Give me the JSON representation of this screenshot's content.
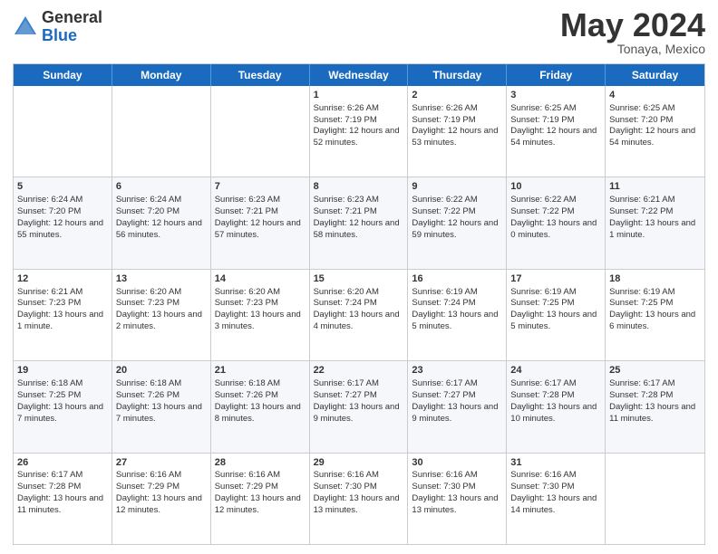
{
  "header": {
    "logo_general": "General",
    "logo_blue": "Blue",
    "month": "May 2024",
    "location": "Tonaya, Mexico"
  },
  "weekdays": [
    "Sunday",
    "Monday",
    "Tuesday",
    "Wednesday",
    "Thursday",
    "Friday",
    "Saturday"
  ],
  "rows": [
    [
      {
        "day": "",
        "sunrise": "",
        "sunset": "",
        "daylight": ""
      },
      {
        "day": "",
        "sunrise": "",
        "sunset": "",
        "daylight": ""
      },
      {
        "day": "",
        "sunrise": "",
        "sunset": "",
        "daylight": ""
      },
      {
        "day": "1",
        "sunrise": "Sunrise: 6:26 AM",
        "sunset": "Sunset: 7:19 PM",
        "daylight": "Daylight: 12 hours and 52 minutes."
      },
      {
        "day": "2",
        "sunrise": "Sunrise: 6:26 AM",
        "sunset": "Sunset: 7:19 PM",
        "daylight": "Daylight: 12 hours and 53 minutes."
      },
      {
        "day": "3",
        "sunrise": "Sunrise: 6:25 AM",
        "sunset": "Sunset: 7:19 PM",
        "daylight": "Daylight: 12 hours and 54 minutes."
      },
      {
        "day": "4",
        "sunrise": "Sunrise: 6:25 AM",
        "sunset": "Sunset: 7:20 PM",
        "daylight": "Daylight: 12 hours and 54 minutes."
      }
    ],
    [
      {
        "day": "5",
        "sunrise": "Sunrise: 6:24 AM",
        "sunset": "Sunset: 7:20 PM",
        "daylight": "Daylight: 12 hours and 55 minutes."
      },
      {
        "day": "6",
        "sunrise": "Sunrise: 6:24 AM",
        "sunset": "Sunset: 7:20 PM",
        "daylight": "Daylight: 12 hours and 56 minutes."
      },
      {
        "day": "7",
        "sunrise": "Sunrise: 6:23 AM",
        "sunset": "Sunset: 7:21 PM",
        "daylight": "Daylight: 12 hours and 57 minutes."
      },
      {
        "day": "8",
        "sunrise": "Sunrise: 6:23 AM",
        "sunset": "Sunset: 7:21 PM",
        "daylight": "Daylight: 12 hours and 58 minutes."
      },
      {
        "day": "9",
        "sunrise": "Sunrise: 6:22 AM",
        "sunset": "Sunset: 7:22 PM",
        "daylight": "Daylight: 12 hours and 59 minutes."
      },
      {
        "day": "10",
        "sunrise": "Sunrise: 6:22 AM",
        "sunset": "Sunset: 7:22 PM",
        "daylight": "Daylight: 13 hours and 0 minutes."
      },
      {
        "day": "11",
        "sunrise": "Sunrise: 6:21 AM",
        "sunset": "Sunset: 7:22 PM",
        "daylight": "Daylight: 13 hours and 1 minute."
      }
    ],
    [
      {
        "day": "12",
        "sunrise": "Sunrise: 6:21 AM",
        "sunset": "Sunset: 7:23 PM",
        "daylight": "Daylight: 13 hours and 1 minute."
      },
      {
        "day": "13",
        "sunrise": "Sunrise: 6:20 AM",
        "sunset": "Sunset: 7:23 PM",
        "daylight": "Daylight: 13 hours and 2 minutes."
      },
      {
        "day": "14",
        "sunrise": "Sunrise: 6:20 AM",
        "sunset": "Sunset: 7:23 PM",
        "daylight": "Daylight: 13 hours and 3 minutes."
      },
      {
        "day": "15",
        "sunrise": "Sunrise: 6:20 AM",
        "sunset": "Sunset: 7:24 PM",
        "daylight": "Daylight: 13 hours and 4 minutes."
      },
      {
        "day": "16",
        "sunrise": "Sunrise: 6:19 AM",
        "sunset": "Sunset: 7:24 PM",
        "daylight": "Daylight: 13 hours and 5 minutes."
      },
      {
        "day": "17",
        "sunrise": "Sunrise: 6:19 AM",
        "sunset": "Sunset: 7:25 PM",
        "daylight": "Daylight: 13 hours and 5 minutes."
      },
      {
        "day": "18",
        "sunrise": "Sunrise: 6:19 AM",
        "sunset": "Sunset: 7:25 PM",
        "daylight": "Daylight: 13 hours and 6 minutes."
      }
    ],
    [
      {
        "day": "19",
        "sunrise": "Sunrise: 6:18 AM",
        "sunset": "Sunset: 7:25 PM",
        "daylight": "Daylight: 13 hours and 7 minutes."
      },
      {
        "day": "20",
        "sunrise": "Sunrise: 6:18 AM",
        "sunset": "Sunset: 7:26 PM",
        "daylight": "Daylight: 13 hours and 7 minutes."
      },
      {
        "day": "21",
        "sunrise": "Sunrise: 6:18 AM",
        "sunset": "Sunset: 7:26 PM",
        "daylight": "Daylight: 13 hours and 8 minutes."
      },
      {
        "day": "22",
        "sunrise": "Sunrise: 6:17 AM",
        "sunset": "Sunset: 7:27 PM",
        "daylight": "Daylight: 13 hours and 9 minutes."
      },
      {
        "day": "23",
        "sunrise": "Sunrise: 6:17 AM",
        "sunset": "Sunset: 7:27 PM",
        "daylight": "Daylight: 13 hours and 9 minutes."
      },
      {
        "day": "24",
        "sunrise": "Sunrise: 6:17 AM",
        "sunset": "Sunset: 7:28 PM",
        "daylight": "Daylight: 13 hours and 10 minutes."
      },
      {
        "day": "25",
        "sunrise": "Sunrise: 6:17 AM",
        "sunset": "Sunset: 7:28 PM",
        "daylight": "Daylight: 13 hours and 11 minutes."
      }
    ],
    [
      {
        "day": "26",
        "sunrise": "Sunrise: 6:17 AM",
        "sunset": "Sunset: 7:28 PM",
        "daylight": "Daylight: 13 hours and 11 minutes."
      },
      {
        "day": "27",
        "sunrise": "Sunrise: 6:16 AM",
        "sunset": "Sunset: 7:29 PM",
        "daylight": "Daylight: 13 hours and 12 minutes."
      },
      {
        "day": "28",
        "sunrise": "Sunrise: 6:16 AM",
        "sunset": "Sunset: 7:29 PM",
        "daylight": "Daylight: 13 hours and 12 minutes."
      },
      {
        "day": "29",
        "sunrise": "Sunrise: 6:16 AM",
        "sunset": "Sunset: 7:30 PM",
        "daylight": "Daylight: 13 hours and 13 minutes."
      },
      {
        "day": "30",
        "sunrise": "Sunrise: 6:16 AM",
        "sunset": "Sunset: 7:30 PM",
        "daylight": "Daylight: 13 hours and 13 minutes."
      },
      {
        "day": "31",
        "sunrise": "Sunrise: 6:16 AM",
        "sunset": "Sunset: 7:30 PM",
        "daylight": "Daylight: 13 hours and 14 minutes."
      },
      {
        "day": "",
        "sunrise": "",
        "sunset": "",
        "daylight": ""
      }
    ]
  ]
}
